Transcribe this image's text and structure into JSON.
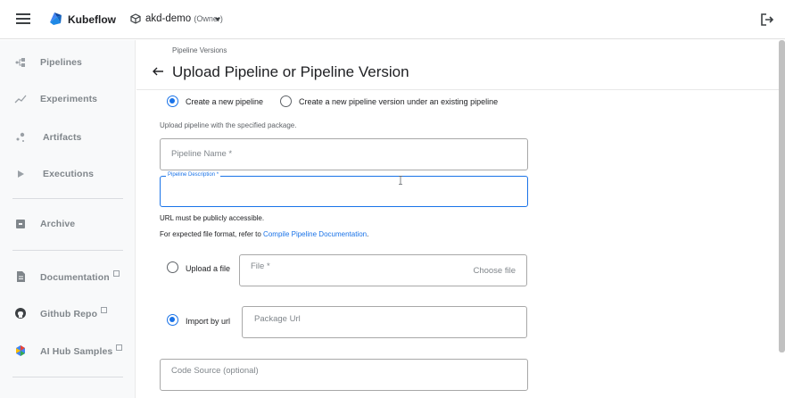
{
  "topbar": {
    "brand": "Kubeflow",
    "namespace": "akd-demo",
    "namespace_role": "(Owner)"
  },
  "sidebar": {
    "items": [
      {
        "label": "Pipelines",
        "icon": "pipelines-icon"
      },
      {
        "label": "Experiments",
        "icon": "experiments-icon"
      },
      {
        "label": "Artifacts",
        "icon": "artifacts-icon"
      },
      {
        "label": "Executions",
        "icon": "executions-icon"
      },
      {
        "label": "Archive",
        "icon": "archive-icon"
      },
      {
        "label": "Documentation",
        "icon": "documentation-icon"
      },
      {
        "label": "Github Repo",
        "icon": "github-icon"
      },
      {
        "label": "AI Hub Samples",
        "icon": "ai-hub-icon"
      }
    ]
  },
  "main": {
    "breadcrumb": "Pipeline Versions",
    "title": "Upload Pipeline or Pipeline Version",
    "mode_options": {
      "new_pipeline": "Create a new pipeline",
      "new_version": "Create a new pipeline version under an existing pipeline"
    },
    "upload_hint": "Upload pipeline with the specified package.",
    "pipeline_name_placeholder": "Pipeline Name *",
    "pipeline_description_label": "Pipeline Description *",
    "url_hint": "URL must be publicly accessible.",
    "format_hint_prefix": "For expected file format, refer to ",
    "format_hint_link": "Compile Pipeline Documentation",
    "format_hint_suffix": ".",
    "upload_file_label": "Upload a file",
    "file_placeholder": "File *",
    "choose_file": "Choose file",
    "import_url_label": "Import by url",
    "package_url_placeholder": "Package Url",
    "code_source_placeholder": "Code Source (optional)"
  },
  "colors": {
    "accent": "#1a73e8",
    "sidebar_text": "#80868b"
  }
}
